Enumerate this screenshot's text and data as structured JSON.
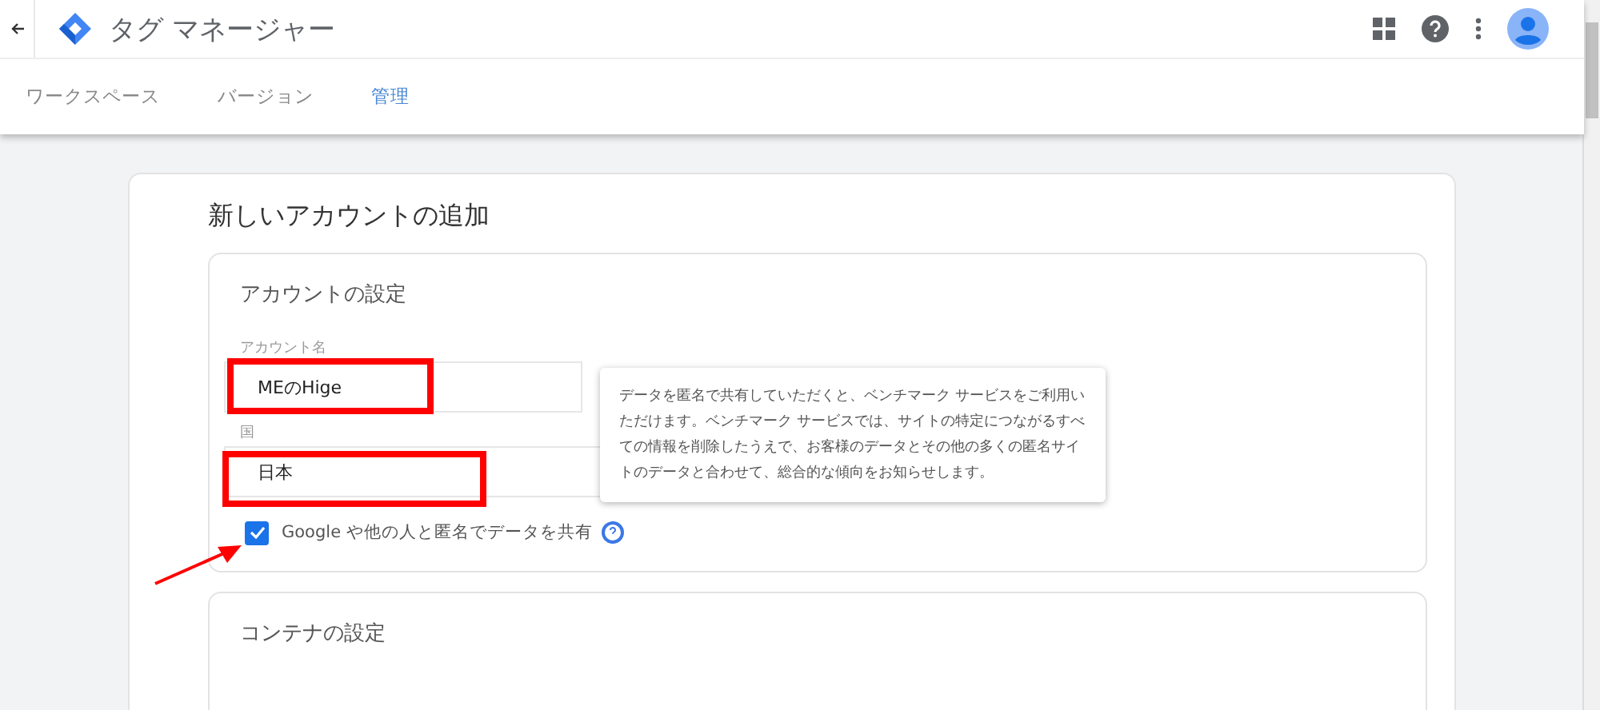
{
  "header": {
    "title": "タグ マネージャー"
  },
  "tabs": [
    {
      "label": "ワークスペース",
      "selected": false
    },
    {
      "label": "バージョン",
      "selected": false
    },
    {
      "label": "管理",
      "selected": true
    }
  ],
  "page_title": "新しいアカウントの追加",
  "account_section": {
    "title": "アカウントの設定",
    "fields": [
      {
        "label": "アカウント名",
        "value": "MEのHige"
      },
      {
        "label": "国",
        "value": "日本"
      }
    ],
    "share_checkbox": {
      "label": "Google や他の人と匿名でデータを共有",
      "checked": true
    }
  },
  "tooltip": "データを匿名で共有していただくと、ベンチマーク サービスをご利用いただけます。ベンチマーク サービスでは、サイトの特定につながるすべての情報を削除したうえで、お客様のデータとその他の多くの匿名サイトのデータと合わせて、総合的な傾向をお知らせします。",
  "container_section": {
    "title": "コンテナの設定"
  }
}
